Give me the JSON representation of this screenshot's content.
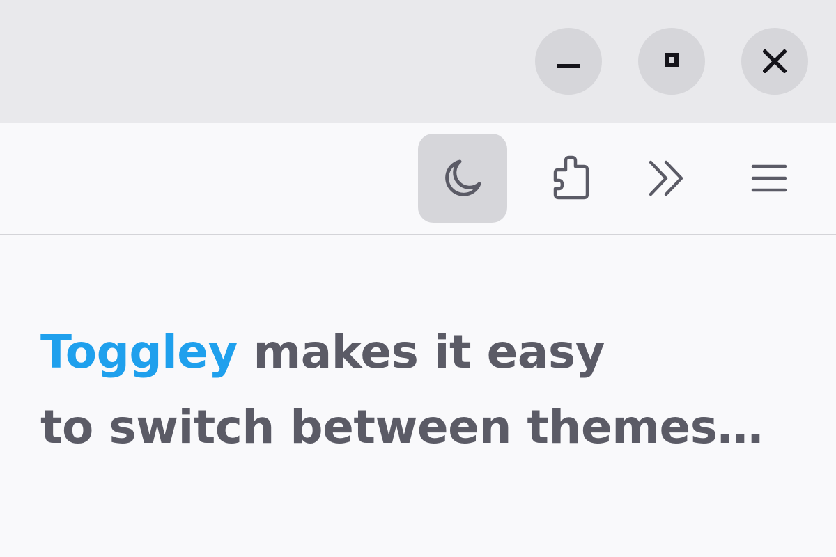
{
  "window_controls": {
    "minimize_icon": "minimize-icon",
    "maximize_icon": "maximize-icon",
    "close_icon": "close-icon"
  },
  "toolbar": {
    "buttons": [
      {
        "icon": "moon-icon",
        "active": true
      },
      {
        "icon": "puzzle-icon",
        "active": false
      },
      {
        "icon": "double-chevron-right-icon",
        "active": false
      },
      {
        "icon": "hamburger-menu-icon",
        "active": false
      }
    ]
  },
  "content": {
    "brand": "Toggley",
    "line1_rest": " makes it easy",
    "line2": "to switch between themes…"
  },
  "colors": {
    "brand": "#1fa0ed",
    "text": "#5b5b66",
    "titlebar": "#e9e9ec",
    "toolbar": "#f9f9fb",
    "button_bg": "#d6d6da",
    "icon": "#5b5b66",
    "window_icon": "#15141a"
  }
}
